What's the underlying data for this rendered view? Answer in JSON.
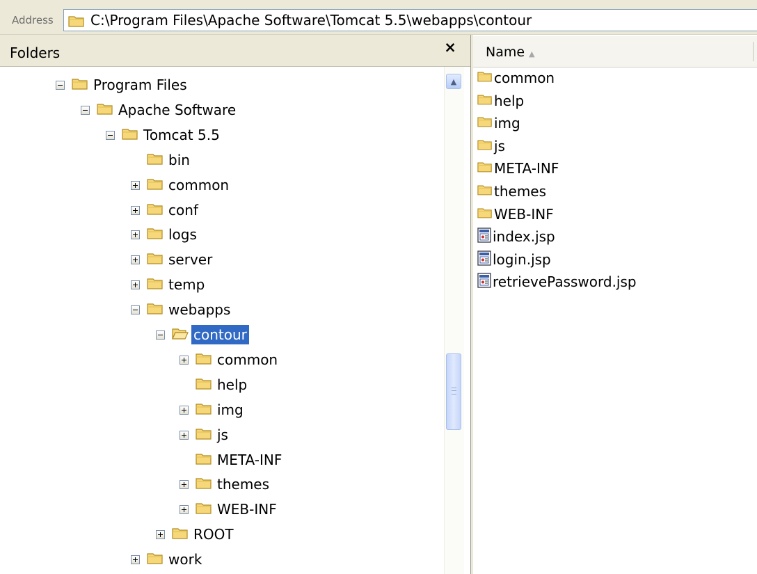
{
  "address_bar": {
    "label": "Address",
    "path": "C:\\Program Files\\Apache Software\\Tomcat 5.5\\webapps\\contour",
    "icon": "folder-icon"
  },
  "folders_pane": {
    "title": "Folders",
    "close_glyph": "×",
    "tree": [
      {
        "label": "Program Files",
        "toggle": "minus"
      },
      {
        "label": "Apache Software",
        "toggle": "minus"
      },
      {
        "label": "Tomcat 5.5",
        "toggle": "minus"
      },
      {
        "label": "bin",
        "toggle": "none"
      },
      {
        "label": "common",
        "toggle": "plus"
      },
      {
        "label": "conf",
        "toggle": "plus"
      },
      {
        "label": "logs",
        "toggle": "plus"
      },
      {
        "label": "server",
        "toggle": "plus"
      },
      {
        "label": "temp",
        "toggle": "plus"
      },
      {
        "label": "webapps",
        "toggle": "minus"
      },
      {
        "label": "contour",
        "toggle": "minus",
        "selected": true
      },
      {
        "label": "common",
        "toggle": "plus"
      },
      {
        "label": "help",
        "toggle": "none"
      },
      {
        "label": "img",
        "toggle": "plus"
      },
      {
        "label": "js",
        "toggle": "plus"
      },
      {
        "label": "META-INF",
        "toggle": "none"
      },
      {
        "label": "themes",
        "toggle": "plus"
      },
      {
        "label": "WEB-INF",
        "toggle": "plus"
      },
      {
        "label": "ROOT",
        "toggle": "plus"
      },
      {
        "label": "work",
        "toggle": "plus"
      }
    ]
  },
  "file_list": {
    "column_name": "Name",
    "sort_glyph": "▲",
    "items": [
      {
        "label": "common",
        "type": "folder"
      },
      {
        "label": "help",
        "type": "folder"
      },
      {
        "label": "img",
        "type": "folder"
      },
      {
        "label": "js",
        "type": "folder"
      },
      {
        "label": "META-INF",
        "type": "folder"
      },
      {
        "label": "themes",
        "type": "folder"
      },
      {
        "label": "WEB-INF",
        "type": "folder"
      },
      {
        "label": "index.jsp",
        "type": "jsp"
      },
      {
        "label": "login.jsp",
        "type": "jsp"
      },
      {
        "label": "retrievePassword.jsp",
        "type": "jsp"
      }
    ]
  },
  "colors": {
    "selection": "#316ac5",
    "folder_fill": "#f6d87a",
    "folder_stroke": "#b08a1e"
  }
}
